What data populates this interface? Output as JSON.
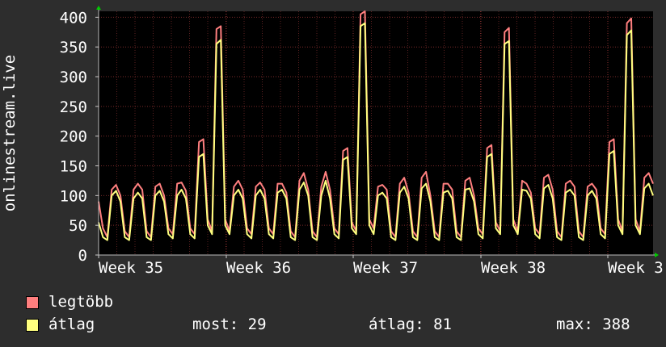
{
  "chart_data": {
    "type": "line",
    "ylabel": "onlinestream.live",
    "ylim": [
      0,
      410
    ],
    "y_ticks": [
      0,
      50,
      100,
      150,
      200,
      250,
      300,
      350,
      400
    ],
    "x_tick_labels": [
      "Week 35",
      "Week 36",
      "Week 37",
      "Week 38",
      "Week 3"
    ],
    "grid": true,
    "x": [
      0,
      0.25,
      0.5,
      0.75,
      1,
      1.25,
      1.5,
      1.75,
      2,
      2.25,
      2.5,
      2.75,
      3,
      3.25,
      3.5,
      3.75,
      4,
      4.25,
      4.5,
      4.75,
      5,
      5.25,
      5.5,
      5.75,
      6,
      6.25,
      6.5,
      6.75,
      7,
      7.25,
      7.5,
      7.75,
      8,
      8.25,
      8.5,
      8.75,
      9,
      9.25,
      9.5,
      9.75,
      10,
      10.25,
      10.5,
      10.75,
      11,
      11.25,
      11.5,
      11.75,
      12,
      12.25,
      12.5,
      12.75,
      13,
      13.25,
      13.5,
      13.75,
      14,
      14.25,
      14.5,
      14.75,
      15,
      15.25,
      15.5,
      15.75,
      16,
      16.25,
      16.5,
      16.75,
      17,
      17.25,
      17.5,
      17.75,
      18,
      18.25,
      18.5,
      18.75,
      19,
      19.25,
      19.5,
      19.75,
      20,
      20.25,
      20.5,
      20.75,
      21,
      21.25,
      21.5,
      21.75,
      22,
      22.25,
      22.5,
      22.75,
      23,
      23.25,
      23.5,
      23.75,
      24,
      24.25,
      24.5,
      24.75,
      25,
      25.25,
      25.5,
      25.75,
      26,
      26.25,
      26.5,
      26.75,
      27,
      27.25,
      27.5,
      27.75,
      28,
      28.25,
      28.5,
      28.75,
      29,
      29.25,
      29.5,
      29.75,
      30,
      30.25,
      30.5,
      30.75,
      31,
      31.25,
      31.5,
      31.75
    ],
    "series": [
      {
        "name": "legtöbb",
        "color": "#ff7f7f",
        "values": [
          90,
          45,
          30,
          110,
          118,
          100,
          40,
          30,
          110,
          120,
          110,
          40,
          30,
          115,
          120,
          100,
          45,
          35,
          120,
          122,
          108,
          45,
          35,
          190,
          195,
          60,
          40,
          380,
          385,
          60,
          40,
          115,
          125,
          110,
          45,
          35,
          115,
          122,
          110,
          45,
          35,
          120,
          120,
          105,
          40,
          30,
          125,
          138,
          110,
          40,
          30,
          115,
          140,
          110,
          45,
          35,
          175,
          180,
          55,
          40,
          405,
          410,
          60,
          45,
          115,
          118,
          110,
          40,
          30,
          120,
          130,
          105,
          40,
          30,
          130,
          140,
          100,
          40,
          30,
          120,
          120,
          110,
          40,
          30,
          125,
          130,
          100,
          45,
          35,
          180,
          185,
          55,
          40,
          375,
          382,
          60,
          40,
          125,
          120,
          105,
          45,
          35,
          130,
          135,
          110,
          40,
          30,
          120,
          125,
          115,
          40,
          30,
          115,
          120,
          110,
          45,
          35,
          190,
          195,
          60,
          40,
          390,
          398,
          60,
          40,
          130,
          138,
          120
        ]
      },
      {
        "name": "átlag",
        "color": "#ffff7f",
        "values": [
          55,
          30,
          25,
          100,
          108,
          90,
          30,
          25,
          95,
          105,
          95,
          30,
          25,
          100,
          108,
          90,
          35,
          28,
          100,
          110,
          95,
          35,
          28,
          165,
          170,
          50,
          35,
          355,
          362,
          50,
          35,
          100,
          110,
          95,
          35,
          28,
          100,
          110,
          95,
          35,
          28,
          105,
          110,
          95,
          30,
          25,
          110,
          122,
          100,
          30,
          25,
          100,
          125,
          95,
          35,
          28,
          160,
          165,
          45,
          35,
          385,
          390,
          50,
          35,
          100,
          105,
          95,
          30,
          25,
          105,
          115,
          95,
          30,
          25,
          112,
          120,
          90,
          30,
          25,
          105,
          108,
          95,
          30,
          25,
          110,
          112,
          90,
          35,
          28,
          165,
          170,
          45,
          35,
          355,
          360,
          50,
          35,
          110,
          108,
          95,
          35,
          28,
          112,
          118,
          95,
          30,
          25,
          105,
          110,
          100,
          30,
          25,
          100,
          108,
          95,
          35,
          28,
          170,
          175,
          50,
          35,
          370,
          378,
          50,
          35,
          112,
          120,
          100
        ]
      }
    ],
    "stats": {
      "current_label": "most: 29",
      "average_label": "átlag: 81",
      "max_label": "max: 388"
    }
  },
  "legend": {
    "max_label": "legtöbb",
    "avg_label": "átlag"
  }
}
